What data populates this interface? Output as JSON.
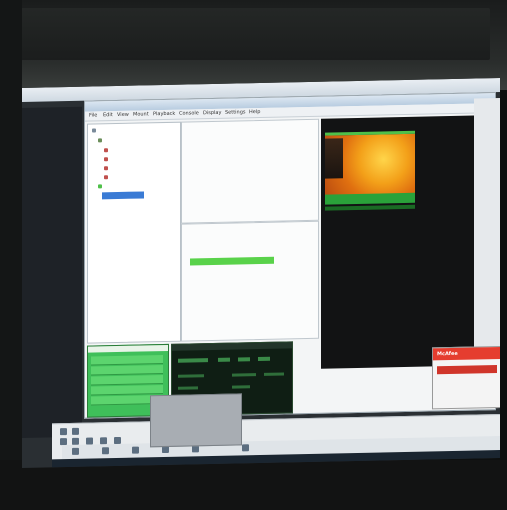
{
  "window": {
    "title": "",
    "app_title": ""
  },
  "menu": {
    "items": [
      "File",
      "Edit",
      "View",
      "Mount",
      "Playback",
      "Console",
      "Display",
      "Settings",
      "Help"
    ]
  },
  "tree": {
    "items": [
      "",
      "",
      "",
      "",
      "",
      "",
      "",
      ""
    ]
  },
  "info": {
    "lines": [
      "",
      "",
      "",
      "",
      "",
      ""
    ]
  },
  "log": {
    "lines": [
      "",
      "",
      ""
    ]
  },
  "image_pane": {
    "label": "",
    "bar_text": ""
  },
  "popup": {
    "title": "McAfee",
    "bar_text": ""
  },
  "colors": {
    "accent_green": "#3fbf5a",
    "thumb_orange": "#f3a019",
    "popup_red": "#e53d2f",
    "selection_blue": "#3a7bd5"
  }
}
